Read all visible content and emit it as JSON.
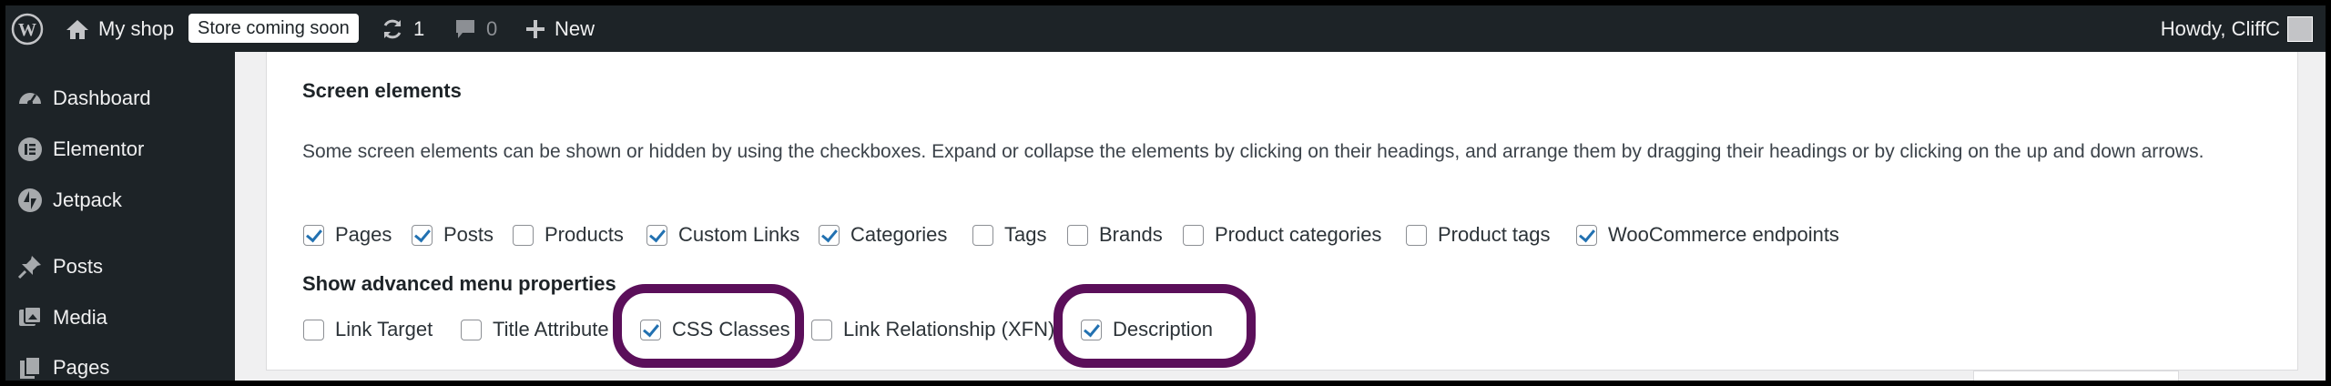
{
  "admin_bar": {
    "site_name": "My shop",
    "store_badge": "Store coming soon",
    "updates_count": "1",
    "comments_count": "0",
    "new_label": "New",
    "greeting": "Howdy, CliffC"
  },
  "sidebar": {
    "items": [
      {
        "label": "Dashboard",
        "icon": "dashboard-icon"
      },
      {
        "label": "Elementor",
        "icon": "elementor-icon"
      },
      {
        "label": "Jetpack",
        "icon": "jetpack-icon"
      },
      {
        "label": "Posts",
        "icon": "pin-icon"
      },
      {
        "label": "Media",
        "icon": "media-icon"
      },
      {
        "label": "Pages",
        "icon": "pages-icon"
      }
    ]
  },
  "screen_options": {
    "title": "Screen elements",
    "description": "Some screen elements can be shown or hidden by using the checkboxes. Expand or collapse the elements by clicking on their headings, and arrange them by dragging their headings or by clicking on the up and down arrows.",
    "elements": [
      {
        "label": "Pages",
        "checked": true
      },
      {
        "label": "Posts",
        "checked": true
      },
      {
        "label": "Products",
        "checked": false
      },
      {
        "label": "Custom Links",
        "checked": true
      },
      {
        "label": "Categories",
        "checked": true
      },
      {
        "label": "Tags",
        "checked": false
      },
      {
        "label": "Brands",
        "checked": false
      },
      {
        "label": "Product categories",
        "checked": false
      },
      {
        "label": "Product tags",
        "checked": false
      },
      {
        "label": "WooCommerce endpoints",
        "checked": true
      }
    ],
    "advanced_title": "Show advanced menu properties",
    "advanced": [
      {
        "label": "Link Target",
        "checked": false
      },
      {
        "label": "Title Attribute",
        "checked": false
      },
      {
        "label": "CSS Classes",
        "checked": true
      },
      {
        "label": "Link Relationship (XFN)",
        "checked": false
      },
      {
        "label": "Description",
        "checked": true
      }
    ]
  },
  "colors": {
    "admin_bar_bg": "#1d2327",
    "check_accent": "#2271b1",
    "highlight_ring": "#5b0f5a"
  }
}
